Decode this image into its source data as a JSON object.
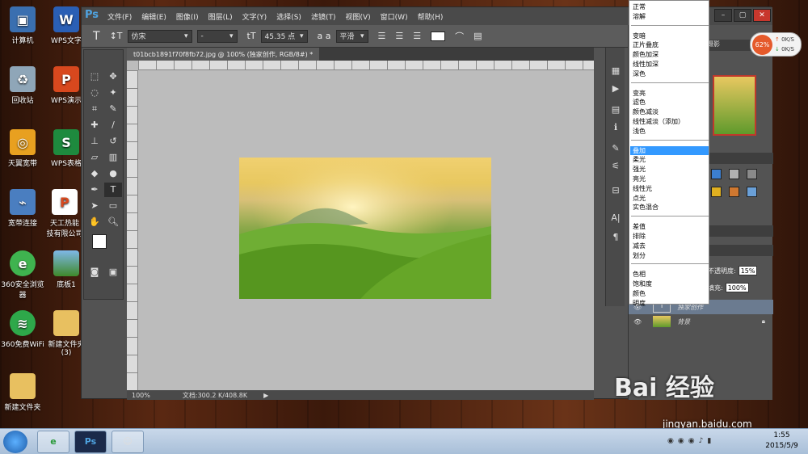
{
  "desktop": {
    "icons": [
      {
        "label": "计算机",
        "icon": "computer-icon"
      },
      {
        "label": "WPS文字",
        "icon": "wps-writer-icon"
      },
      {
        "label": "回收站",
        "icon": "recycle-bin-icon"
      },
      {
        "label": "WPS演示",
        "icon": "wps-presentation-icon"
      },
      {
        "label": "天翼宽带",
        "icon": "broadband-icon"
      },
      {
        "label": "WPS表格",
        "icon": "wps-spreadsheet-icon"
      },
      {
        "label": "宽带连接",
        "icon": "network-icon"
      },
      {
        "label": "天工热能\n技有限公司",
        "icon": "document-icon"
      },
      {
        "label": "360安全浏览\n器",
        "icon": "browser-icon"
      },
      {
        "label": "底板1",
        "icon": "image-icon"
      },
      {
        "label": "360免费WiFi",
        "icon": "wifi-icon"
      },
      {
        "label": "新建文件夹\n(3)",
        "icon": "folder-icon"
      },
      {
        "label": "新建文件夹",
        "icon": "folder-icon"
      }
    ]
  },
  "photoshop": {
    "logo": "Ps",
    "menu": [
      "文件(F)",
      "编辑(E)",
      "图像(I)",
      "图层(L)",
      "文字(Y)",
      "选择(S)",
      "滤镜(T)",
      "视图(V)",
      "窗口(W)",
      "帮助(H)"
    ],
    "options": {
      "font_family": "仿宋",
      "font_style": "-",
      "font_size": "45.35 点",
      "aa_label": "a a",
      "aa_mode": "平滑"
    },
    "document_tab": "t01bcb1891f70f8fb72.jpg @ 100% (独家创作, RGB/8#) *",
    "status": {
      "zoom": "100%",
      "doc": "文档:300.2 K/408.8K"
    },
    "layers_panel": {
      "opacity_label": "不透明度:",
      "opacity_value": "15%",
      "fill_label": "填充:",
      "fill_value": "100%",
      "layers": [
        {
          "name": "独家创作"
        },
        {
          "name": "背景"
        }
      ],
      "panel_tab": "摄影"
    },
    "blend_modes": [
      [
        "正常",
        "溶解"
      ],
      [
        "变暗",
        "正片叠底",
        "颜色加深",
        "线性加深",
        "深色"
      ],
      [
        "变亮",
        "滤色",
        "颜色减淡",
        "线性减淡（添加）",
        "浅色"
      ],
      [
        "叠加",
        "柔光",
        "强光",
        "亮光",
        "线性光",
        "点光",
        "实色混合"
      ],
      [
        "差值",
        "排除",
        "减去",
        "划分"
      ],
      [
        "色相",
        "饱和度",
        "颜色",
        "明度"
      ]
    ],
    "blend_selected": "叠加"
  },
  "net_gauge": {
    "percent": "62%",
    "up": "0K/S",
    "down": "0K/S"
  },
  "watermark": {
    "main": "Bai 经验",
    "sub": "jingyan.baidu.com"
  },
  "taskbar": {
    "time": "1:55",
    "date": "2015/5/9",
    "ps_label": "Ps"
  }
}
